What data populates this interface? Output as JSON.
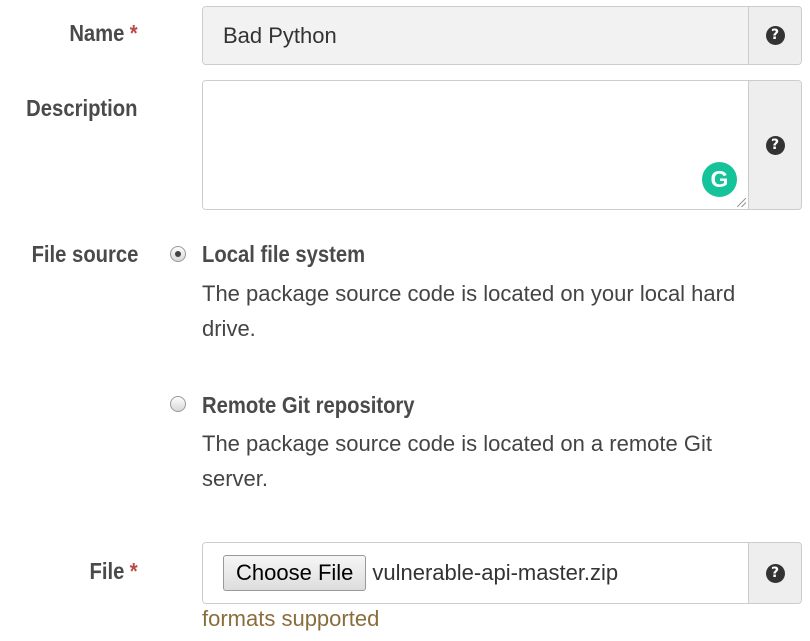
{
  "name_field": {
    "label": "Name",
    "required_marker": "*",
    "value": "Bad Python",
    "help_icon": "question-circle-icon"
  },
  "description_field": {
    "label": "Description",
    "value": "",
    "help_icon": "question-circle-icon",
    "grammarly_icon": "grammarly-icon",
    "grammarly_letter": "G"
  },
  "file_source": {
    "label": "File source",
    "options": [
      {
        "title": "Local file system",
        "help_text": "The package source code is located on your local hard drive.",
        "selected": true
      },
      {
        "title": "Remote Git repository",
        "help_text": "The package source code is located on a remote Git server.",
        "selected": false
      }
    ]
  },
  "file_field": {
    "label": "File",
    "required_marker": "*",
    "button_label": "Choose File",
    "file_name": "vulnerable-api-master.zip",
    "help_icon": "question-circle-icon",
    "hint": "formats supported"
  },
  "colors": {
    "required": "#b94a48",
    "hint": "#8a6d3b",
    "grammarly": "#15c39a"
  }
}
